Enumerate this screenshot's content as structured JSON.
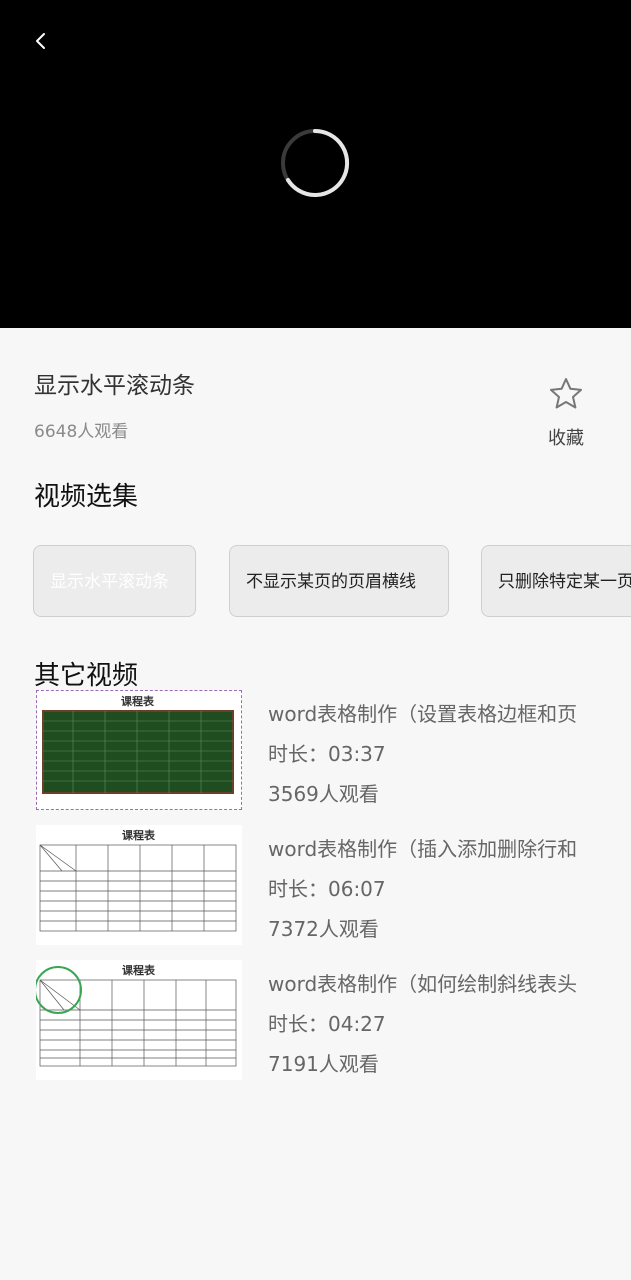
{
  "player": {
    "back_icon": "chevron-left-icon",
    "loading_icon": "loading-spinner-icon"
  },
  "video": {
    "title": "显示水平滚动条",
    "views": "6648人观看",
    "favorite_label": "收藏",
    "favorite_icon": "star-outline-icon"
  },
  "episodes_section": {
    "title": "视频选集",
    "items": [
      {
        "label": "显示水平滚动条",
        "active": true
      },
      {
        "label": "不显示某页的页眉横线",
        "active": false
      },
      {
        "label": "只删除特定某一页",
        "active": false
      }
    ]
  },
  "other_section": {
    "title": "其它视频",
    "items": [
      {
        "title": "word表格制作（设置表格边框和页",
        "duration": "时长：03:37",
        "views": "3569人观看",
        "thumb_heading": "课程表"
      },
      {
        "title": "word表格制作（插入添加删除行和",
        "duration": "时长：06:07",
        "views": "7372人观看",
        "thumb_heading": "课程表"
      },
      {
        "title": "word表格制作（如何绘制斜线表头",
        "duration": "时长：04:27",
        "views": "7191人观看",
        "thumb_heading": "课程表"
      }
    ]
  },
  "colors": {
    "player_bg": "#000000",
    "page_bg": "#f7f7f7",
    "thumb_green": "#1f4d1f",
    "thumb_circle": "#3aa655"
  }
}
